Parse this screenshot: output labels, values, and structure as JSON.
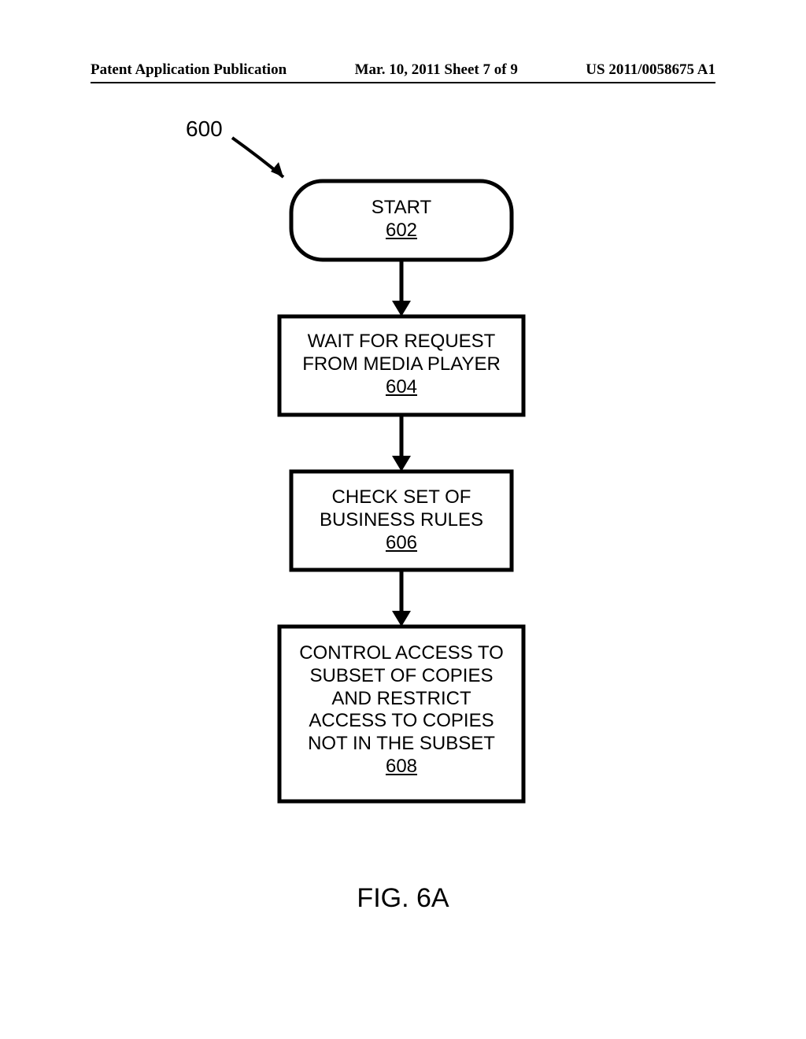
{
  "header": {
    "left": "Patent Application Publication",
    "center": "Mar. 10, 2011  Sheet 7 of 9",
    "right": "US 2011/0058675 A1"
  },
  "ref_label": "600",
  "blocks": {
    "start": {
      "title": "START",
      "num": "602"
    },
    "wait": {
      "line1": "WAIT FOR REQUEST",
      "line2": "FROM MEDIA PLAYER",
      "num": "604"
    },
    "check": {
      "line1": "CHECK SET OF",
      "line2": "BUSINESS RULES",
      "num": "606"
    },
    "control": {
      "line1": "CONTROL ACCESS TO",
      "line2": "SUBSET OF COPIES",
      "line3": "AND RESTRICT",
      "line4": "ACCESS TO COPIES",
      "line5": "NOT IN THE SUBSET",
      "num": "608"
    }
  },
  "caption": "FIG. 6A"
}
